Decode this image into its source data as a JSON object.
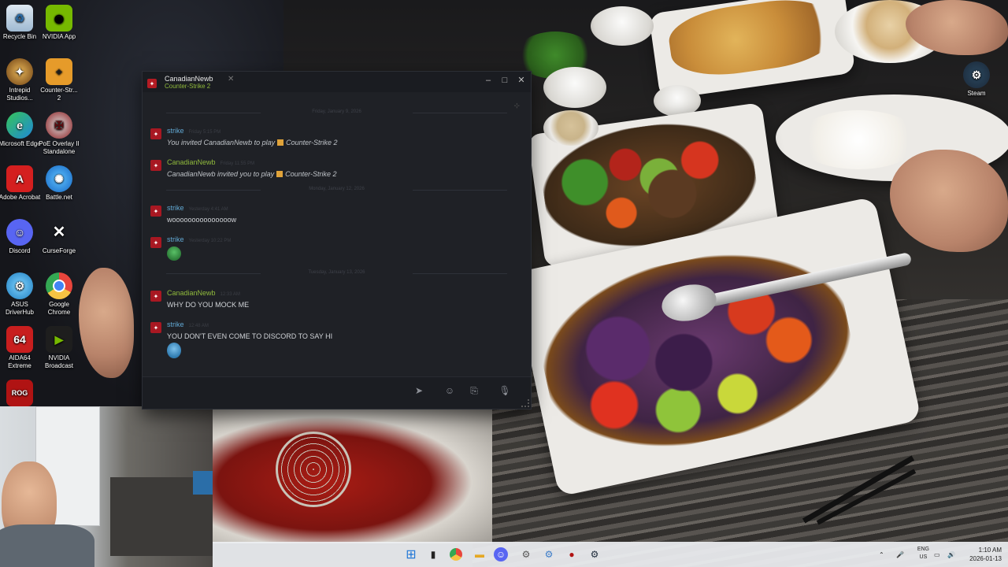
{
  "desktop": {
    "icons": [
      {
        "label": "Recycle Bin",
        "icon": "recycle-bin-icon",
        "color": "#5aa7e6"
      },
      {
        "label": "NVIDIA App",
        "icon": "nvidia-icon",
        "color": "#76b900"
      },
      {
        "label": "Intrepid Studios...",
        "icon": "intrepid-icon",
        "color": "#b07a2a"
      },
      {
        "label": "Counter-Str... 2",
        "icon": "counter-strike-icon",
        "color": "#e69b2a"
      },
      {
        "label": "Microsoft Edge",
        "icon": "edge-icon",
        "color": "#1f9bd6"
      },
      {
        "label": "PoE Overlay II Standalone",
        "icon": "poe-overlay-icon",
        "color": "#b3242a"
      },
      {
        "label": "Adobe Acrobat",
        "icon": "acrobat-icon",
        "color": "#d41f1f"
      },
      {
        "label": "Battle.net",
        "icon": "battlenet-icon",
        "color": "#1c8fe0"
      },
      {
        "label": "Discord",
        "icon": "discord-icon",
        "color": "#5865f2"
      },
      {
        "label": "CurseForge",
        "icon": "curseforge-icon",
        "color": "#222222"
      },
      {
        "label": "ASUS DriverHub",
        "icon": "asus-icon",
        "color": "#2a9bd9"
      },
      {
        "label": "Google Chrome",
        "icon": "chrome-icon",
        "color": "#e8453c"
      },
      {
        "label": "AIDA64 Extreme",
        "icon": "aida64-icon",
        "color": "#c81e1e"
      },
      {
        "label": "NVIDIA Broadcast",
        "icon": "nvidia-broadcast-icon",
        "color": "#1e1e1e"
      },
      {
        "label": "",
        "icon": "rog-cpl-icon",
        "color": "#b01313"
      },
      {
        "label": "Steam",
        "icon": "steam-icon",
        "color": "#1b2838"
      }
    ]
  },
  "chat": {
    "tab_name": "CanadianNewb",
    "tab_game": "Counter-Strike 2",
    "day_separators": [
      "Friday, January 9, 2026",
      "Monday, January 12, 2026",
      "Tuesday, January 13, 2026"
    ],
    "messages": [
      {
        "author": "strike",
        "time": "Friday 5:15 PM",
        "text_prefix": "You invited CanadianNewb to play",
        "game": "Counter-Strike 2"
      },
      {
        "author": "CanadianNewb",
        "time": "Friday 11:55 PM",
        "text_prefix": "CanadianNewb invited you to play",
        "game": "Counter-Strike 2"
      },
      {
        "author": "strike",
        "time": "Yesterday 4:41 AM",
        "text": "wooooooooooooooow"
      },
      {
        "author": "strike",
        "time": "Yesterday 10:22 PM",
        "emoji": "green-emoji-icon"
      },
      {
        "author": "CanadianNewb",
        "time": "12:33 AM",
        "text": "WHY DO YOU MOCK ME"
      },
      {
        "author": "strike",
        "time": "12:48 AM",
        "text": "YOU DON'T EVEN COME TO DISCORD TO SAY HI",
        "emoji": "blue-emoji-icon"
      }
    ],
    "input_placeholder": ""
  },
  "taskbar": {
    "lang_line1": "ENG",
    "lang_line2": "US",
    "time": "1:10 AM",
    "date": "2026-01-13"
  },
  "colors": {
    "strike_name": "#61a8d3",
    "canadian_name": "#90ba3c",
    "chat_bg": "#1f2126"
  }
}
